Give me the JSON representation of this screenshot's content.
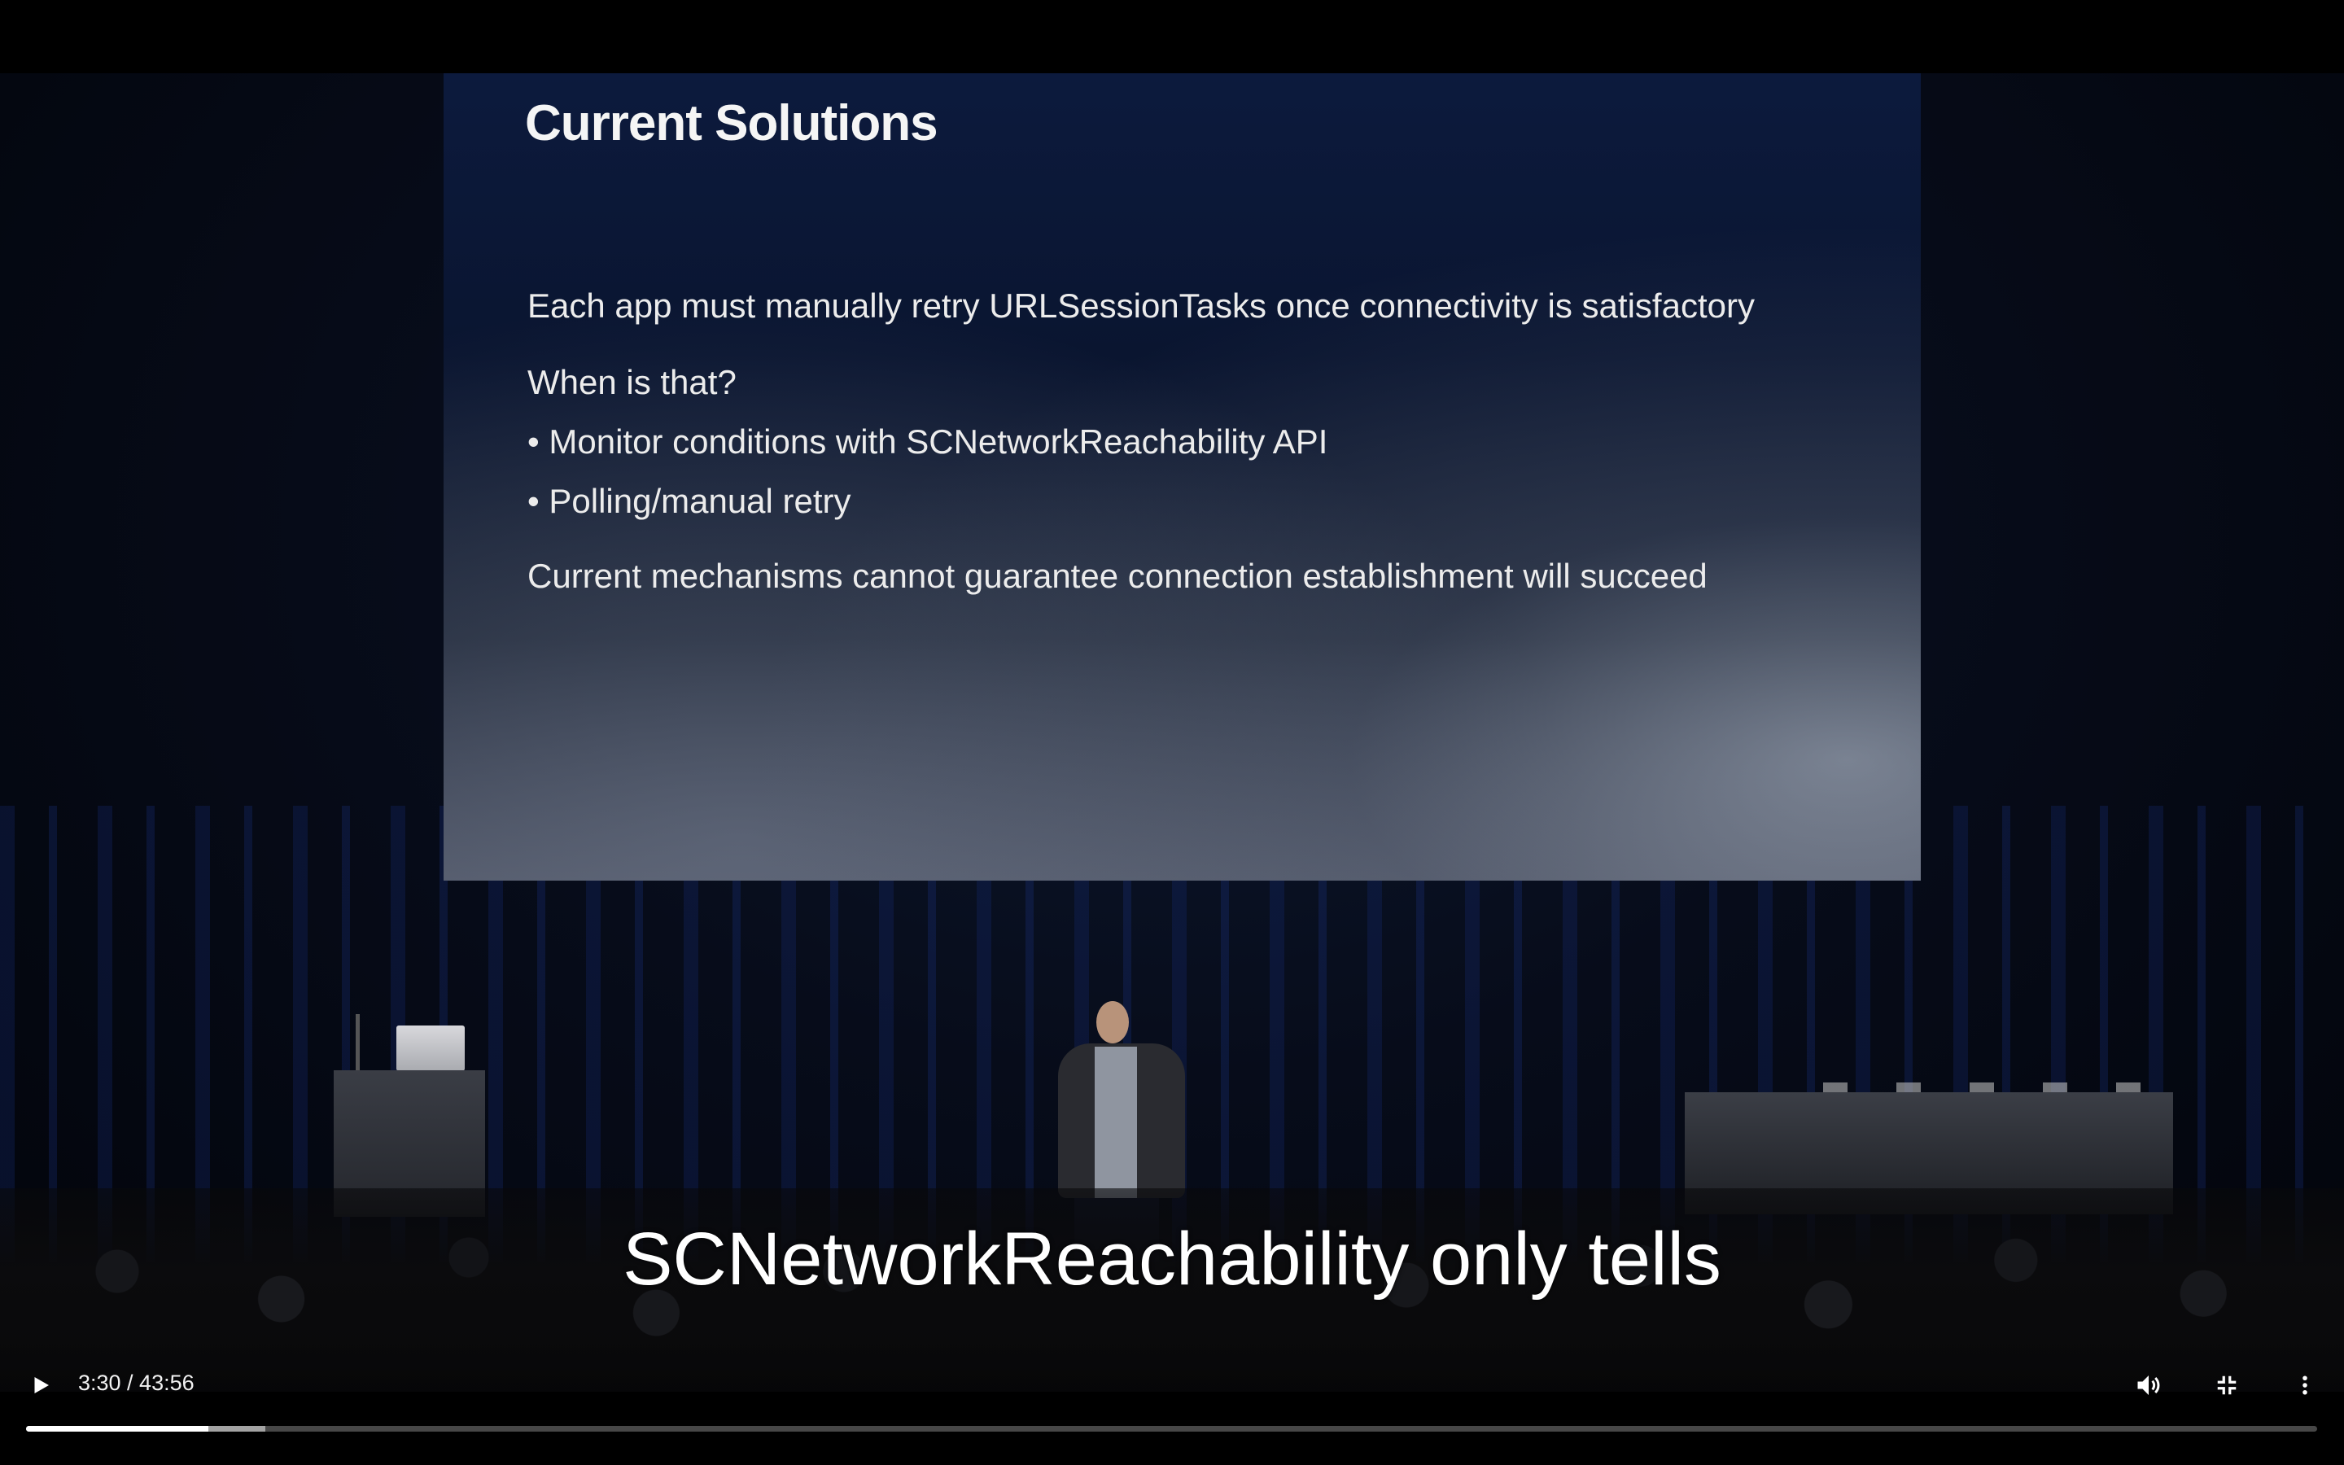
{
  "slide": {
    "title": "Current Solutions",
    "lines": [
      "Each app must manually retry URLSessionTasks once connectivity is satisfactory",
      "When is that?",
      "• Monitor conditions with SCNetworkReachability API",
      "• Polling/manual retry",
      "Current mechanisms cannot guarantee connection establishment will succeed"
    ]
  },
  "caption": "SCNetworkReachability only tells",
  "controls": {
    "play_icon": "play-icon",
    "time_display": "3:30 / 43:56",
    "volume_icon": "volume-icon",
    "fullscreen_icon": "exit-fullscreen-icon",
    "more_icon": "more-vertical-icon",
    "progress": {
      "played_fraction": 0.0797,
      "buffered_fraction": 0.1045
    }
  }
}
